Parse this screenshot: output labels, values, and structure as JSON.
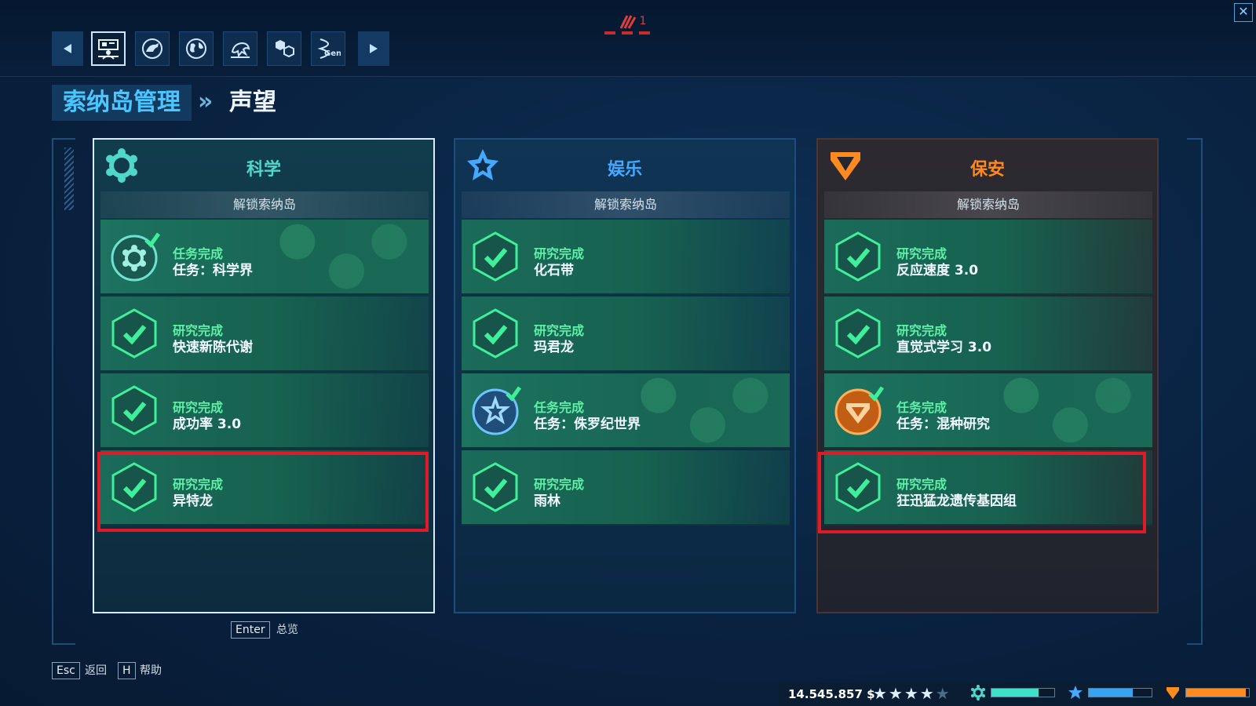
{
  "header": {
    "tabs": [
      {
        "name": "park-management-tab",
        "active": true
      },
      {
        "name": "dinosaur-tab",
        "active": false
      },
      {
        "name": "world-tab",
        "active": false
      },
      {
        "name": "fossil-tab",
        "active": false
      },
      {
        "name": "research-tab",
        "active": false
      },
      {
        "name": "genome-tab",
        "active": false
      }
    ],
    "genome_tab_label": "Gen",
    "alert_count": "1"
  },
  "breadcrumb": {
    "parent": "索纳岛管理",
    "separator": "»",
    "current": "声望"
  },
  "columns": [
    {
      "title": "科学",
      "subtitle": "解锁索纳岛",
      "accent": "#4fd7c9",
      "items": [
        {
          "status": "任务完成",
          "name": "任务：科学界",
          "type": "mission"
        },
        {
          "status": "研究完成",
          "name": "快速新陈代谢",
          "type": "research"
        },
        {
          "status": "研究完成",
          "name": "成功率 3.0",
          "type": "research"
        },
        {
          "status": "研究完成",
          "name": "异特龙",
          "type": "research",
          "highlighted": true
        }
      ]
    },
    {
      "title": "娱乐",
      "subtitle": "解锁索纳岛",
      "accent": "#46a8ff",
      "items": [
        {
          "status": "研究完成",
          "name": "化石带",
          "type": "research"
        },
        {
          "status": "研究完成",
          "name": "玛君龙",
          "type": "research"
        },
        {
          "status": "任务完成",
          "name": "任务：侏罗纪世界",
          "type": "mission"
        },
        {
          "status": "研究完成",
          "name": "雨林",
          "type": "research"
        }
      ]
    },
    {
      "title": "保安",
      "subtitle": "解锁索纳岛",
      "accent": "#ff8a1f",
      "items": [
        {
          "status": "研究完成",
          "name": "反应速度 3.0",
          "type": "research"
        },
        {
          "status": "研究完成",
          "name": "直觉式学习 3.0",
          "type": "research"
        },
        {
          "status": "任务完成",
          "name": "任务：混种研究",
          "type": "mission"
        },
        {
          "status": "研究完成",
          "name": "狂迅猛龙遗传基因组",
          "type": "research",
          "highlighted": true
        }
      ]
    }
  ],
  "footer": {
    "enter_key": "Enter",
    "enter_label": "总览",
    "esc_key": "Esc",
    "esc_label": "返回",
    "help_key": "H",
    "help_label": "帮助"
  },
  "status": {
    "money": "14.545.857 $",
    "rating": 4,
    "rating_max": 5,
    "science_level": 0.75,
    "entertainment_level": 0.7,
    "security_level": 0.95
  },
  "colors": {
    "science": "#4fd7c9",
    "entertainment": "#46a8ff",
    "security": "#ff8a1f",
    "complete_text": "#5ef0a5",
    "highlight": "#e01a26"
  }
}
